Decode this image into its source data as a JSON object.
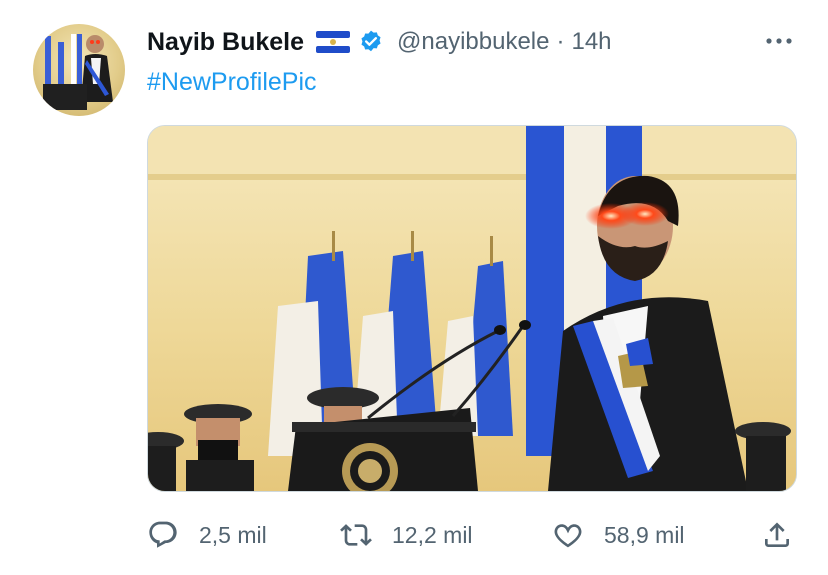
{
  "tweet": {
    "author": {
      "name": "Nayib Bukele",
      "handle": "@nayibbukele",
      "flag_icon": "el-salvador-flag-icon",
      "verified_icon": "verified-badge-icon"
    },
    "separator": "·",
    "timestamp": "14h",
    "text": "#NewProfilePic",
    "media": {
      "subject": "man in dark suit with blue and white presidential sash standing at a podium with two microphones, red glowing eyes, blue and white flags and uniformed honor guards behind"
    },
    "actions": {
      "replies": "2,5 mil",
      "retweets": "12,2 mil",
      "likes": "58,9 mil"
    }
  },
  "colors": {
    "accent": "#1d9bf0",
    "secondary_text": "#536471",
    "primary_text": "#0f1419",
    "flag_blue": "#1f4cc9"
  },
  "icons": [
    "more-options-icon",
    "reply-icon",
    "retweet-icon",
    "like-icon",
    "share-icon"
  ]
}
